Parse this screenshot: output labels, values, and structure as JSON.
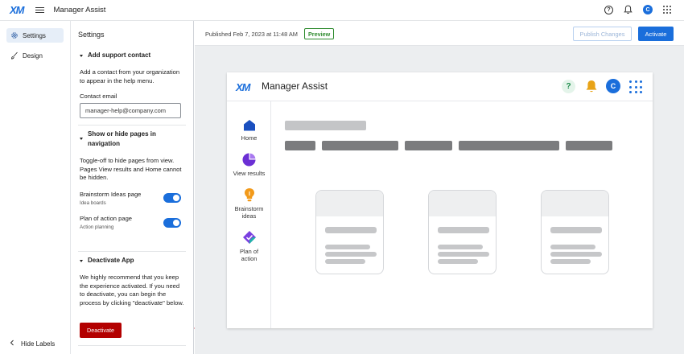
{
  "topbar": {
    "logo": "XM",
    "app_title": "Manager Assist",
    "help_icon": "question-circle-icon",
    "notify_icon": "bell-icon",
    "avatar_letter": "C",
    "apps_icon": "grid-dots-icon"
  },
  "leftnav": {
    "items": [
      {
        "label": "Settings",
        "icon": "gear-icon",
        "active": true
      },
      {
        "label": "Design",
        "icon": "brush-icon",
        "active": false
      }
    ],
    "hide_labels": "Hide Labels"
  },
  "settings": {
    "title": "Settings",
    "support": {
      "heading": "Add support contact",
      "description": "Add a contact from your organization to appear in the help menu.",
      "email_label": "Contact email",
      "email_value": "manager-help@company.com"
    },
    "pages": {
      "heading": "Show or hide pages in navigation",
      "description": "Toggle-off to hide pages from view. Pages View results and Home cannot be hidden.",
      "toggles": [
        {
          "label": "Brainstorm Ideas page",
          "sub": "Idea boards",
          "on": true
        },
        {
          "label": "Plan of action page",
          "sub": "Action planning",
          "on": true
        }
      ]
    },
    "deactivate": {
      "heading": "Deactivate App",
      "description": "We highly recommend that you keep the experience activated. If you need to deactivate, you can begin the process by clicking \"deactivate\" below.",
      "button": "Deactivate"
    }
  },
  "main": {
    "published": "Published Feb 7, 2023 at 11:48 AM",
    "preview_badge": "Preview",
    "publish_button": "Publish Changes",
    "activate_button": "Activate"
  },
  "preview": {
    "logo": "XM",
    "title": "Manager Assist",
    "help_glyph": "?",
    "avatar_letter": "C",
    "nav": [
      {
        "label": "Home",
        "icon": "house-icon"
      },
      {
        "label": "View results",
        "icon": "pie-chart-icon"
      },
      {
        "label": "Brainstorm ideas",
        "icon": "lightbulb-icon"
      },
      {
        "label": "Plan of action",
        "icon": "diamond-check-icon"
      }
    ]
  },
  "colors": {
    "accent": "#1a6edb",
    "danger": "#b30000",
    "success": "#2e8b2e",
    "annotation_arrow": "#c0283a"
  }
}
